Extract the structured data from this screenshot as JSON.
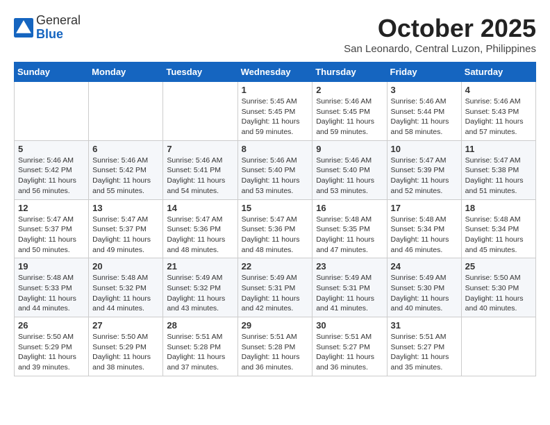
{
  "header": {
    "logo": {
      "general": "General",
      "blue": "Blue"
    },
    "title": "October 2025",
    "location": "San Leonardo, Central Luzon, Philippines"
  },
  "weekdays": [
    "Sunday",
    "Monday",
    "Tuesday",
    "Wednesday",
    "Thursday",
    "Friday",
    "Saturday"
  ],
  "weeks": [
    [
      {
        "day": "",
        "sunrise": "",
        "sunset": "",
        "daylight": ""
      },
      {
        "day": "",
        "sunrise": "",
        "sunset": "",
        "daylight": ""
      },
      {
        "day": "",
        "sunrise": "",
        "sunset": "",
        "daylight": ""
      },
      {
        "day": "1",
        "sunrise": "Sunrise: 5:45 AM",
        "sunset": "Sunset: 5:45 PM",
        "daylight": "Daylight: 11 hours and 59 minutes."
      },
      {
        "day": "2",
        "sunrise": "Sunrise: 5:46 AM",
        "sunset": "Sunset: 5:45 PM",
        "daylight": "Daylight: 11 hours and 59 minutes."
      },
      {
        "day": "3",
        "sunrise": "Sunrise: 5:46 AM",
        "sunset": "Sunset: 5:44 PM",
        "daylight": "Daylight: 11 hours and 58 minutes."
      },
      {
        "day": "4",
        "sunrise": "Sunrise: 5:46 AM",
        "sunset": "Sunset: 5:43 PM",
        "daylight": "Daylight: 11 hours and 57 minutes."
      }
    ],
    [
      {
        "day": "5",
        "sunrise": "Sunrise: 5:46 AM",
        "sunset": "Sunset: 5:42 PM",
        "daylight": "Daylight: 11 hours and 56 minutes."
      },
      {
        "day": "6",
        "sunrise": "Sunrise: 5:46 AM",
        "sunset": "Sunset: 5:42 PM",
        "daylight": "Daylight: 11 hours and 55 minutes."
      },
      {
        "day": "7",
        "sunrise": "Sunrise: 5:46 AM",
        "sunset": "Sunset: 5:41 PM",
        "daylight": "Daylight: 11 hours and 54 minutes."
      },
      {
        "day": "8",
        "sunrise": "Sunrise: 5:46 AM",
        "sunset": "Sunset: 5:40 PM",
        "daylight": "Daylight: 11 hours and 53 minutes."
      },
      {
        "day": "9",
        "sunrise": "Sunrise: 5:46 AM",
        "sunset": "Sunset: 5:40 PM",
        "daylight": "Daylight: 11 hours and 53 minutes."
      },
      {
        "day": "10",
        "sunrise": "Sunrise: 5:47 AM",
        "sunset": "Sunset: 5:39 PM",
        "daylight": "Daylight: 11 hours and 52 minutes."
      },
      {
        "day": "11",
        "sunrise": "Sunrise: 5:47 AM",
        "sunset": "Sunset: 5:38 PM",
        "daylight": "Daylight: 11 hours and 51 minutes."
      }
    ],
    [
      {
        "day": "12",
        "sunrise": "Sunrise: 5:47 AM",
        "sunset": "Sunset: 5:37 PM",
        "daylight": "Daylight: 11 hours and 50 minutes."
      },
      {
        "day": "13",
        "sunrise": "Sunrise: 5:47 AM",
        "sunset": "Sunset: 5:37 PM",
        "daylight": "Daylight: 11 hours and 49 minutes."
      },
      {
        "day": "14",
        "sunrise": "Sunrise: 5:47 AM",
        "sunset": "Sunset: 5:36 PM",
        "daylight": "Daylight: 11 hours and 48 minutes."
      },
      {
        "day": "15",
        "sunrise": "Sunrise: 5:47 AM",
        "sunset": "Sunset: 5:36 PM",
        "daylight": "Daylight: 11 hours and 48 minutes."
      },
      {
        "day": "16",
        "sunrise": "Sunrise: 5:48 AM",
        "sunset": "Sunset: 5:35 PM",
        "daylight": "Daylight: 11 hours and 47 minutes."
      },
      {
        "day": "17",
        "sunrise": "Sunrise: 5:48 AM",
        "sunset": "Sunset: 5:34 PM",
        "daylight": "Daylight: 11 hours and 46 minutes."
      },
      {
        "day": "18",
        "sunrise": "Sunrise: 5:48 AM",
        "sunset": "Sunset: 5:34 PM",
        "daylight": "Daylight: 11 hours and 45 minutes."
      }
    ],
    [
      {
        "day": "19",
        "sunrise": "Sunrise: 5:48 AM",
        "sunset": "Sunset: 5:33 PM",
        "daylight": "Daylight: 11 hours and 44 minutes."
      },
      {
        "day": "20",
        "sunrise": "Sunrise: 5:48 AM",
        "sunset": "Sunset: 5:32 PM",
        "daylight": "Daylight: 11 hours and 44 minutes."
      },
      {
        "day": "21",
        "sunrise": "Sunrise: 5:49 AM",
        "sunset": "Sunset: 5:32 PM",
        "daylight": "Daylight: 11 hours and 43 minutes."
      },
      {
        "day": "22",
        "sunrise": "Sunrise: 5:49 AM",
        "sunset": "Sunset: 5:31 PM",
        "daylight": "Daylight: 11 hours and 42 minutes."
      },
      {
        "day": "23",
        "sunrise": "Sunrise: 5:49 AM",
        "sunset": "Sunset: 5:31 PM",
        "daylight": "Daylight: 11 hours and 41 minutes."
      },
      {
        "day": "24",
        "sunrise": "Sunrise: 5:49 AM",
        "sunset": "Sunset: 5:30 PM",
        "daylight": "Daylight: 11 hours and 40 minutes."
      },
      {
        "day": "25",
        "sunrise": "Sunrise: 5:50 AM",
        "sunset": "Sunset: 5:30 PM",
        "daylight": "Daylight: 11 hours and 40 minutes."
      }
    ],
    [
      {
        "day": "26",
        "sunrise": "Sunrise: 5:50 AM",
        "sunset": "Sunset: 5:29 PM",
        "daylight": "Daylight: 11 hours and 39 minutes."
      },
      {
        "day": "27",
        "sunrise": "Sunrise: 5:50 AM",
        "sunset": "Sunset: 5:29 PM",
        "daylight": "Daylight: 11 hours and 38 minutes."
      },
      {
        "day": "28",
        "sunrise": "Sunrise: 5:51 AM",
        "sunset": "Sunset: 5:28 PM",
        "daylight": "Daylight: 11 hours and 37 minutes."
      },
      {
        "day": "29",
        "sunrise": "Sunrise: 5:51 AM",
        "sunset": "Sunset: 5:28 PM",
        "daylight": "Daylight: 11 hours and 36 minutes."
      },
      {
        "day": "30",
        "sunrise": "Sunrise: 5:51 AM",
        "sunset": "Sunset: 5:27 PM",
        "daylight": "Daylight: 11 hours and 36 minutes."
      },
      {
        "day": "31",
        "sunrise": "Sunrise: 5:51 AM",
        "sunset": "Sunset: 5:27 PM",
        "daylight": "Daylight: 11 hours and 35 minutes."
      },
      {
        "day": "",
        "sunrise": "",
        "sunset": "",
        "daylight": ""
      }
    ]
  ]
}
